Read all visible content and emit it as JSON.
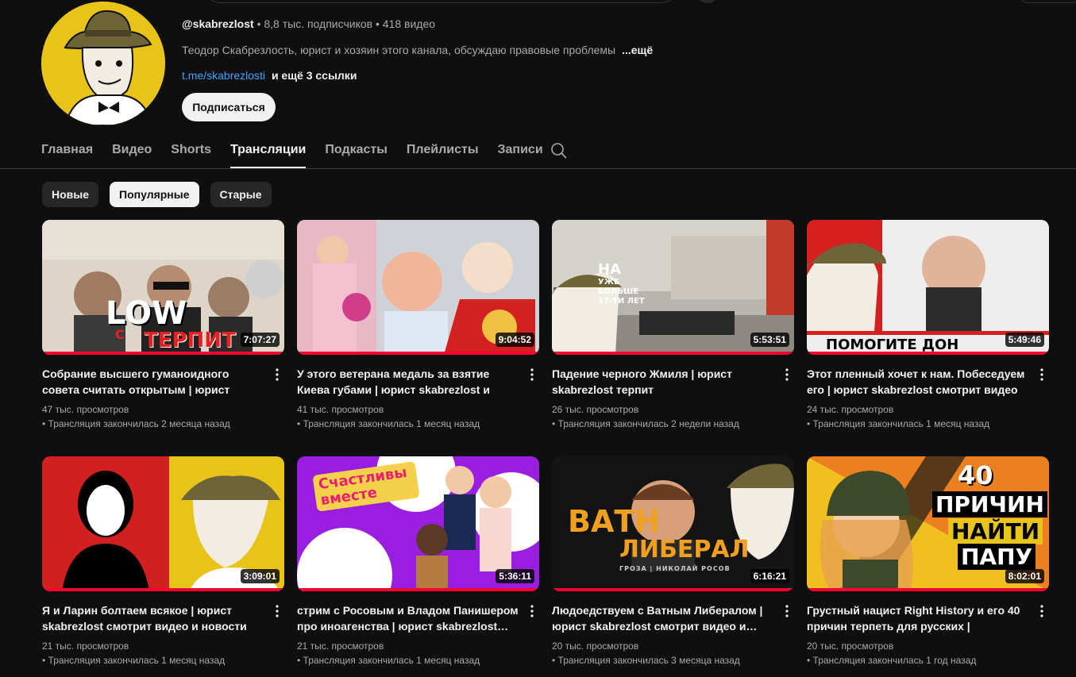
{
  "channel": {
    "handle": "@skabrezlost",
    "subscribers": "8,8 тыс. подписчиков",
    "video_count": "418 видео",
    "separator": "•",
    "description": "Теодор Скабрезлость, юрист и хозяин этого канала, обсуждаю правовые проблемы",
    "more_label": "...ещё",
    "link_text": "t.me/skabrezlosti",
    "extra_links_text": "и ещё 3 ссылки",
    "subscribe_label": "Подписаться"
  },
  "tabs": [
    {
      "label": "Главная",
      "active": false
    },
    {
      "label": "Видео",
      "active": false
    },
    {
      "label": "Shorts",
      "active": false
    },
    {
      "label": "Трансляции",
      "active": true
    },
    {
      "label": "Подкасты",
      "active": false
    },
    {
      "label": "Плейлисты",
      "active": false
    },
    {
      "label": "Записи",
      "active": false
    }
  ],
  "chips": [
    {
      "label": "Новые",
      "active": false
    },
    {
      "label": "Популярные",
      "active": true
    },
    {
      "label": "Старые",
      "active": false
    }
  ],
  "colors": {
    "background": "#0f0f0f",
    "accent_red": "#ff0033",
    "link_blue": "#3ea6ff",
    "avatar_yellow": "#e8c319"
  },
  "thumb_text": {
    "v1_low": "LOW",
    "v1_s": "С",
    "v1_terpit": "ТЕРПИТ",
    "v3_na": "НА",
    "v3_sub": "УЖЕ БОЛЬШЕ 17-ТИ ЛЕТ",
    "v4_banner": "ПОМОГИТЕ ДОН",
    "v6_happy": "Счастливы вместе",
    "v7_vat": "ВАТН",
    "v7_lib": "ЛИБЕРАЛ",
    "v7_credits": "ГРОЗА | НИКОЛАЙ РОСОВ",
    "v8_40": "40",
    "v8_prichin": "ПРИЧИН",
    "v8_naiti": "НАЙТИ",
    "v8_papu": "ПАПУ"
  },
  "videos": [
    {
      "title": "Собрание высшего гуманоидного совета считать открытым | юрист skabrezlost…",
      "duration": "7:07:27",
      "views": "47 тыс. просмотров",
      "status": "• Трансляция закончилась 2 месяца назад"
    },
    {
      "title": "У этого ветерана медаль за взятие Киева губами | юрист skabrezlost и ветеран…",
      "duration": "9:04:52",
      "views": "41 тыс. просмотров",
      "status": "• Трансляция закончилась 1 месяц назад"
    },
    {
      "title": "Падение черного Жмиля | юрист skabrezlost терпит",
      "duration": "5:53:51",
      "views": "26 тыс. просмотров",
      "status": "• Трансляция закончилась 2 недели назад"
    },
    {
      "title": "Этот пленный хочет к нам. Побеседуем его | юрист skabrezlost смотрит видео и…",
      "duration": "5:49:46",
      "views": "24 тыс. просмотров",
      "status": "• Трансляция закончилась 1 месяц назад"
    },
    {
      "title": "Я и Ларин болтаем всякое | юрист skabrezlost смотрит видео и новости",
      "duration": "3:09:01",
      "views": "21 тыс. просмотров",
      "status": "• Трансляция закончилась 1 месяц назад"
    },
    {
      "title": "стрим с Росовым и Владом Панишером про иноагенства | юрист skabrezlost…",
      "duration": "5:36:11",
      "views": "21 тыс. просмотров",
      "status": "• Трансляция закончилась 1 месяц назад"
    },
    {
      "title": "Людоедствуем с Ватным Либералом | юрист skabrezlost смотрит видео и…",
      "duration": "6:16:21",
      "views": "20 тыс. просмотров",
      "status": "• Трансляция закончилась 3 месяца назад"
    },
    {
      "title": "Грустный нацист Right History и его 40 причин терпеть для русских | skabrezlost…",
      "duration": "8:02:01",
      "views": "20 тыс. просмотров",
      "status": "• Трансляция закончилась 1 год назад"
    }
  ]
}
